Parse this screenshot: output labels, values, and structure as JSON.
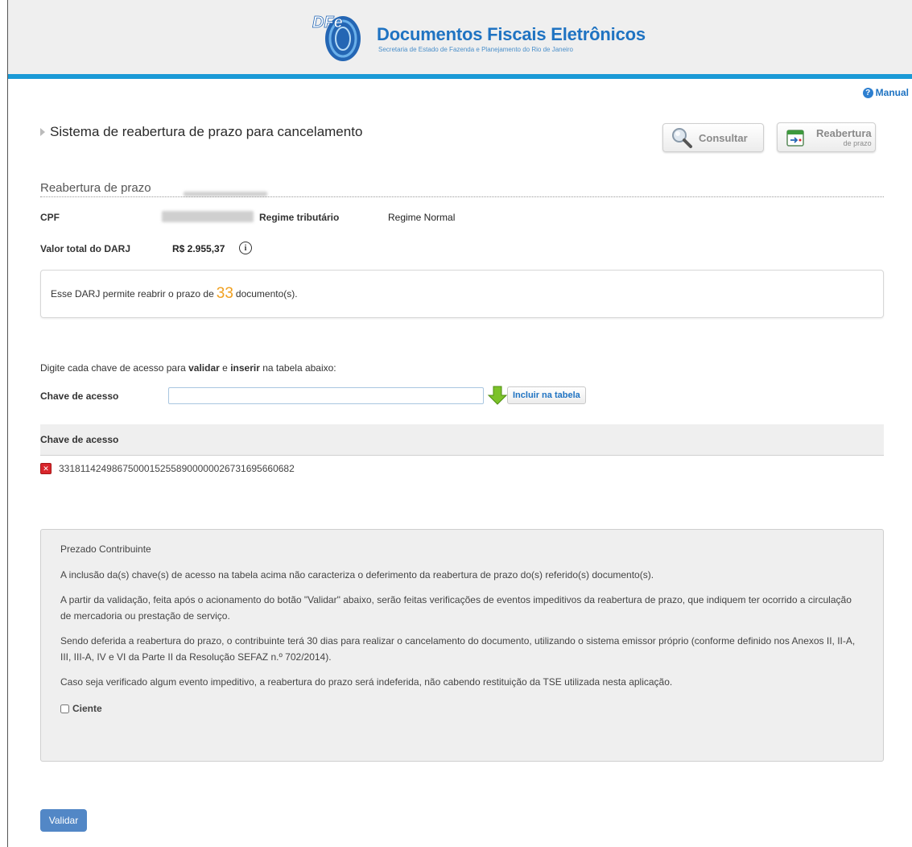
{
  "header": {
    "logo_text": "DFe",
    "title": "Documentos Fiscais Eletrônicos",
    "subtitle": "Secretaria de Estado de Fazenda e Planejamento do Rio de Janeiro",
    "accent_color": "#1a9ad6"
  },
  "manual": {
    "label": "Manual",
    "icon": "help-icon"
  },
  "page": {
    "title": "Sistema de reabertura de prazo para cancelamento"
  },
  "toolbar": {
    "consultar_label": "Consultar",
    "reabertura_label": "Reabertura",
    "reabertura_sub": "de prazo"
  },
  "section": {
    "title": "Reabertura de prazo"
  },
  "fields": {
    "cpf_label": "CPF",
    "regime_label": "Regime tributário",
    "regime_value": "Regime Normal",
    "valor_label": "Valor total do DARJ",
    "valor_value": "R$ 2.955,37",
    "info_glyph": "i"
  },
  "notice": {
    "prefix": "Esse DARJ permite reabrir o prazo de",
    "count": "33",
    "suffix": "documento(s)."
  },
  "instruction": {
    "part1": "Digite cada chave de acesso para",
    "bold1": "validar",
    "part2": "e",
    "bold2": "inserir",
    "part3": "na tabela abaixo:"
  },
  "key_input": {
    "label": "Chave de acesso",
    "value": "",
    "include_label": "Incluir na tabela"
  },
  "table": {
    "header": "Chave de acesso",
    "rows": [
      {
        "key": "33181142498675000152558900000026731695660682"
      }
    ]
  },
  "panel": {
    "greeting": "Prezado Contribuinte",
    "p1": "A inclusão da(s) chave(s) de acesso na tabela acima não caracteriza o deferimento da reabertura de prazo do(s) referido(s) documento(s).",
    "p2": "A partir da validação, feita após o acionamento do botão \"Validar\" abaixo, serão feitas verificações de eventos impeditivos da reabertura de prazo, que indiquem ter ocorrido a circulação de mercadoria ou prestação de serviço.",
    "p3": "Sendo deferida a reabertura do prazo, o contribuinte terá 30 dias para realizar o cancelamento do documento, utilizando o sistema emissor próprio (conforme definido nos Anexos II, II-A, III, III-A, IV e VI da Parte II da Resolução SEFAZ n.º 702/2014).",
    "p4": "Caso seja verificado algum evento impeditivo, a reabertura do prazo será indeferida, não cabendo restituição da TSE utilizada nesta aplicação.",
    "ciente_label": "Ciente",
    "ciente_checked": false
  },
  "actions": {
    "validar_label": "Validar",
    "validar_color": "#5287c6"
  }
}
